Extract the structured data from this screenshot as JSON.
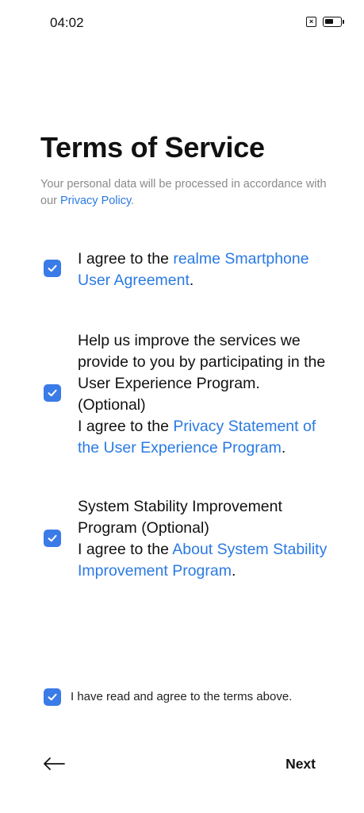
{
  "status_bar": {
    "time": "04:02",
    "sim_icon": "sim-off-icon",
    "battery_icon": "battery-icon"
  },
  "page": {
    "title": "Terms of Service",
    "subtitle_prefix": "Your personal data will be processed in accordance with our ",
    "subtitle_link": "Privacy Policy",
    "subtitle_suffix": "."
  },
  "items": [
    {
      "checked": true,
      "text_prefix": "I agree to the ",
      "link": "realme Smartphone User Agreement",
      "text_suffix": "."
    },
    {
      "checked": true,
      "intro": "Help us improve the services we provide to you by participating in the User Experience Program. (Optional)",
      "text_prefix": "I agree to the ",
      "link": "Privacy Statement of the User Experience Program",
      "text_suffix": "."
    },
    {
      "checked": true,
      "intro": "System Stability Improvement Program (Optional)",
      "text_prefix": "I agree to the ",
      "link": "About System Stability Improvement Program",
      "text_suffix": "."
    }
  ],
  "footer": {
    "checked": true,
    "label": "I have read and agree to the terms above."
  },
  "nav": {
    "back_icon": "arrow-left-icon",
    "next_label": "Next"
  },
  "colors": {
    "accent": "#3a7be8",
    "link": "#2a7ae2",
    "subtitle": "#8a8a8a"
  }
}
